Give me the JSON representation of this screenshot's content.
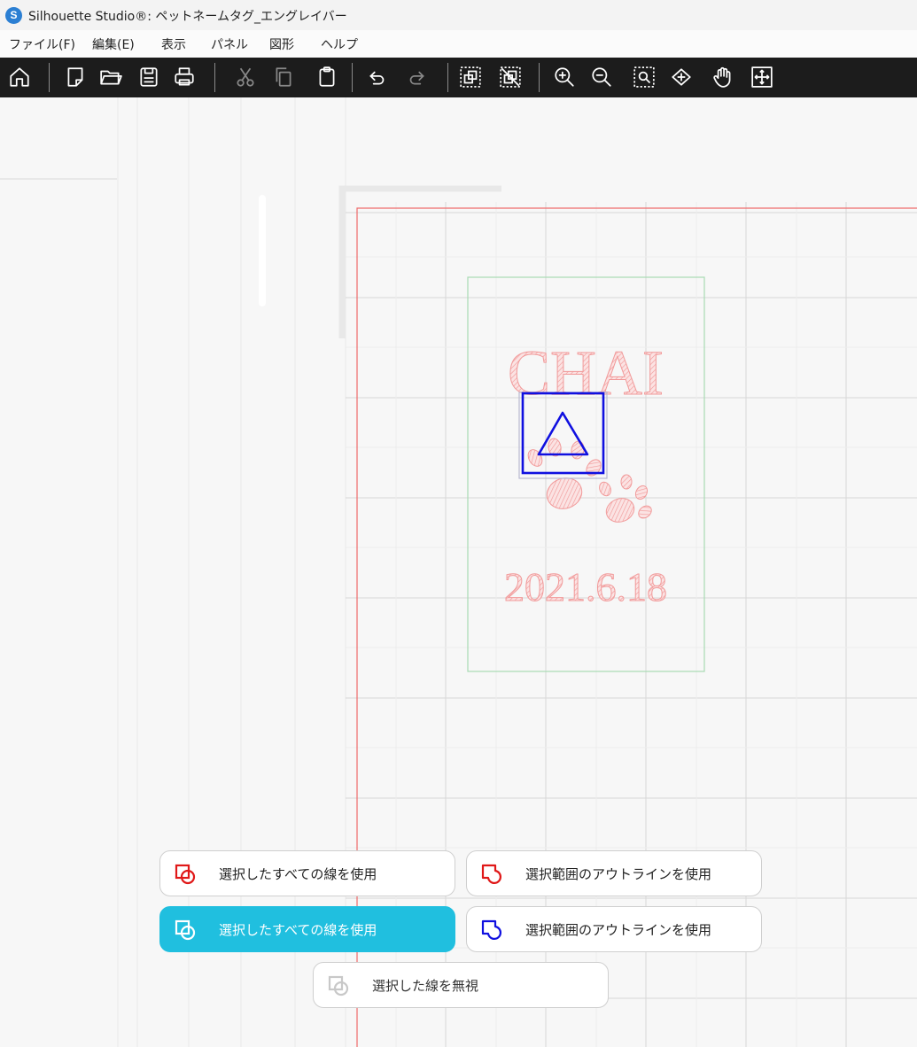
{
  "window": {
    "title": "Silhouette Studio®: ペットネームタグ_エングレイバー",
    "logo_glyph": "S"
  },
  "menu": [
    {
      "label": "ファイル(F)"
    },
    {
      "label": "編集(E)"
    },
    {
      "label": "表示"
    },
    {
      "label": "パネル"
    },
    {
      "label": "図形"
    },
    {
      "label": "ヘルプ"
    }
  ],
  "toolbar": {
    "icons": [
      "home-icon",
      "new-document-icon",
      "open-folder-icon",
      "save-icon",
      "print-icon",
      "cut-icon",
      "copy-icon",
      "paste-icon",
      "undo-icon",
      "redo-icon",
      "group-icon",
      "ungroup-icon",
      "zoom-in-icon",
      "zoom-out-icon",
      "zoom-selection-icon",
      "fit-to-page-icon",
      "pan-hand-icon",
      "fit-to-window-icon"
    ]
  },
  "design": {
    "name_text": "CHAI",
    "date_text": "2021.6.18",
    "colors": {
      "cut_border": "#ee6b6b",
      "safe_area": "#a8dcb4",
      "engrave_text": "#f4aaaa",
      "selected_shape": "#1010e0",
      "grid": "#dcdcdc"
    }
  },
  "options": [
    {
      "label": "選択したすべての線を使用",
      "icon": "all-lines-red-icon",
      "state": "normal"
    },
    {
      "label": "選択範囲のアウトラインを使用",
      "icon": "outline-red-icon",
      "state": "normal"
    },
    {
      "label": "選択したすべての線を使用",
      "icon": "all-lines-white-icon",
      "state": "active"
    },
    {
      "label": "選択範囲のアウトラインを使用",
      "icon": "outline-blue-icon",
      "state": "normal"
    },
    {
      "label": "選択した線を無視",
      "icon": "ignore-lines-icon",
      "state": "disabled"
    }
  ],
  "accent_color": "#20bfdf"
}
